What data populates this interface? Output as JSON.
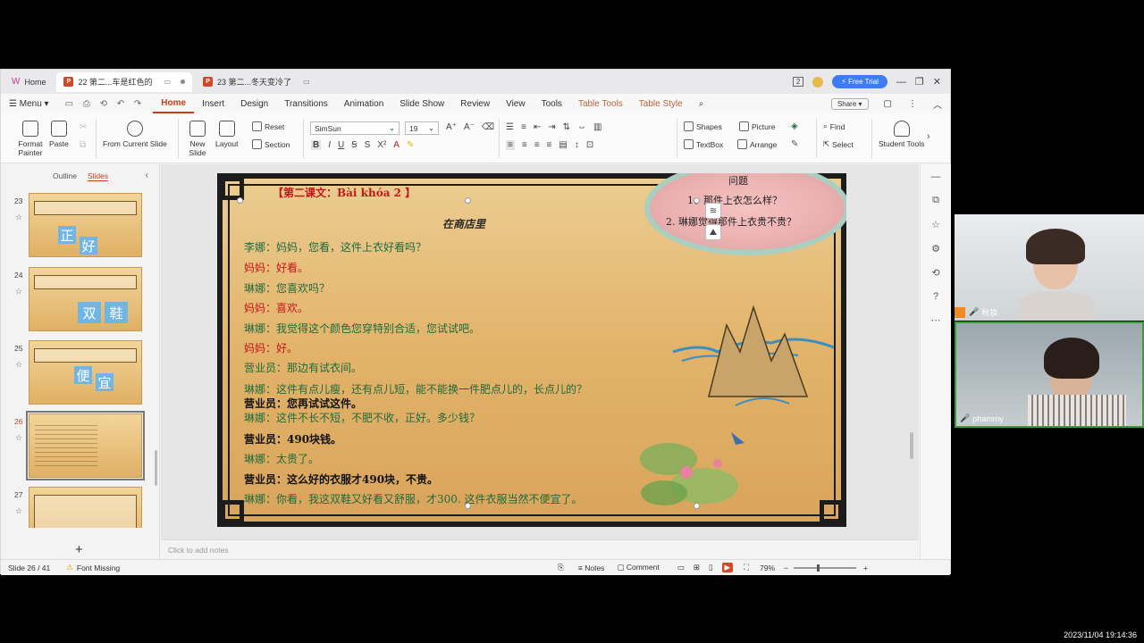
{
  "tabs": [
    {
      "label": "Home"
    },
    {
      "label": "22 第二...车是红色的"
    },
    {
      "label": "23 第二...冬天变冷了"
    }
  ],
  "titlebar": {
    "page_indicator": "2",
    "free_trial": "Free Trial"
  },
  "menu": {
    "menu_label": "Menu",
    "items": [
      "Home",
      "Insert",
      "Design",
      "Transitions",
      "Animation",
      "Slide Show",
      "Review",
      "View",
      "Tools"
    ],
    "table_items": [
      "Table Tools",
      "Table Style"
    ],
    "share": "Share"
  },
  "ribbon": {
    "format_painter": "Format Painter",
    "paste": "Paste",
    "from_current_slide": "From Current Slide",
    "new_slide": "New Slide",
    "layout": "Layout",
    "reset": "Reset",
    "section": "Section",
    "font_name": "SimSun",
    "font_size": "19",
    "shapes": "Shapes",
    "picture": "Picture",
    "textbox": "TextBox",
    "arrange": "Arrange",
    "find": "Find",
    "select": "Select",
    "student_tools": "Student Tools"
  },
  "left_panel": {
    "tab_outline": "Outline",
    "tab_slides": "Slides",
    "thumbs": [
      {
        "num": "23",
        "tiles": [
          "正",
          "好"
        ]
      },
      {
        "num": "24",
        "tiles": [
          "双",
          "鞋"
        ]
      },
      {
        "num": "25",
        "tiles": [
          "便",
          "宜"
        ]
      },
      {
        "num": "26",
        "tiles": []
      },
      {
        "num": "27",
        "tiles": []
      }
    ]
  },
  "slide": {
    "lesson_title": "【第二课文：Bài khóa 2 】",
    "scene_title": "在商店里",
    "question_title": "问题",
    "question_1": "1、那件上衣怎么样？",
    "question_2": "2. 琳娜觉得那件上衣贵不贵？",
    "lines": [
      {
        "text": "李娜：妈妈，您看，这件上衣好看吗？",
        "color": "green"
      },
      {
        "text": "妈妈：好看。",
        "color": "red"
      },
      {
        "text": "琳娜：您喜欢吗？",
        "color": "green"
      },
      {
        "text": "妈妈：喜欢。",
        "color": "red"
      },
      {
        "text": "琳娜：我觉得这个颜色您穿特别合适，您试试吧。",
        "color": "green"
      },
      {
        "text": "妈妈：好。",
        "color": "red"
      },
      {
        "text": "营业员：那边有试衣间。",
        "color": "green"
      },
      {
        "text": "琳娜：这件有点儿瘦，还有点儿短，能不能换一件肥点儿的，长点儿的？",
        "color": "green"
      },
      {
        "text": "营业员：您再试试这件。",
        "color": "black"
      },
      {
        "text": "琳娜：这件不长不短，不肥不收，正好。多少钱？",
        "color": "green"
      },
      {
        "text": "营业员：490块钱。",
        "color": "black"
      },
      {
        "text": "琳娜：太贵了。",
        "color": "green"
      },
      {
        "text": "营业员：这么好的衣服才490块，不贵。",
        "color": "black"
      },
      {
        "text": "琳娜：你看，我这双鞋又好看又舒服，才300. 这件衣服当然不便宜了。",
        "color": "green"
      }
    ]
  },
  "notes_placeholder": "Click to add notes",
  "status": {
    "slide_counter": "Slide 26 / 41",
    "font_missing": "Font Missing",
    "notes": "Notes",
    "comment": "Comment",
    "zoom": "79%"
  },
  "participants": [
    {
      "name": "秋妆"
    },
    {
      "name": "phammy"
    }
  ],
  "timestamp": "2023/11/04 19:14:36",
  "colors": {
    "accent": "#c43e1c",
    "slide_green": "#1d6b3e",
    "slide_red": "#c4161c"
  }
}
